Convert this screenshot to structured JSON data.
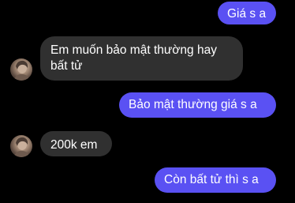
{
  "conversation": {
    "messages": [
      {
        "direction": "outgoing",
        "text": "Giá s a"
      },
      {
        "direction": "incoming",
        "text": "Em muốn bảo mật thường hay bất tử"
      },
      {
        "direction": "outgoing",
        "text": "Bảo mật thường giá s a"
      },
      {
        "direction": "incoming",
        "text": "200k em"
      },
      {
        "direction": "outgoing",
        "text": "Còn bất tử thì s a"
      }
    ]
  },
  "colors": {
    "background": "#000000",
    "outgoing_bubble": "#5a51f3",
    "incoming_bubble": "#303030",
    "text": "#ffffff"
  },
  "icons": {
    "contact_avatar": "avatar-photo"
  }
}
